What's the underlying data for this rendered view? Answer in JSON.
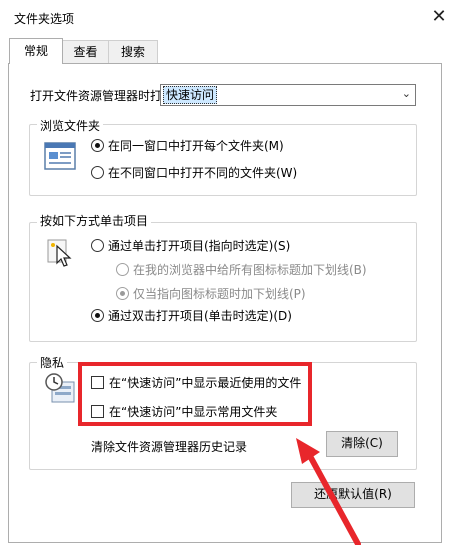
{
  "window": {
    "title": "文件夹选项",
    "close_glyph": "✕"
  },
  "tabs": [
    {
      "label": "常规",
      "active": true
    },
    {
      "label": "查看",
      "active": false
    },
    {
      "label": "搜索",
      "active": false
    }
  ],
  "open_explorer": {
    "label": "打开文件资源管理器时打",
    "selected": "快速访问",
    "arrow": "⌄"
  },
  "browse_folders": {
    "title": "浏览文件夹",
    "options": [
      {
        "label": "在同一窗口中打开每个文件夹(M)",
        "checked": true
      },
      {
        "label": "在不同窗口中打开不同的文件夹(W)",
        "checked": false
      }
    ]
  },
  "click_items": {
    "title": "按如下方式单击项目",
    "options": [
      {
        "label": "通过单击打开项目(指向时选定)(S)",
        "checked": false
      },
      {
        "label": "在我的浏览器中给所有图标标题加下划线(B)",
        "checked": false,
        "disabled": true
      },
      {
        "label": "仅当指向图标标题时加下划线(P)",
        "checked": true,
        "disabled": true
      },
      {
        "label": "通过双击打开项目(单击时选定)(D)",
        "checked": true
      }
    ]
  },
  "privacy": {
    "title": "隐私",
    "checkboxes": [
      {
        "label": "在“快速访问”中显示最近使用的文件",
        "checked": false
      },
      {
        "label": "在“快速访问”中显示常用文件夹",
        "checked": false
      }
    ],
    "clear_label": "清除文件资源管理器历史记录",
    "clear_button": "清除(C)"
  },
  "restore_button": "还原默认值(R)",
  "annotation_color": "#e8262b"
}
